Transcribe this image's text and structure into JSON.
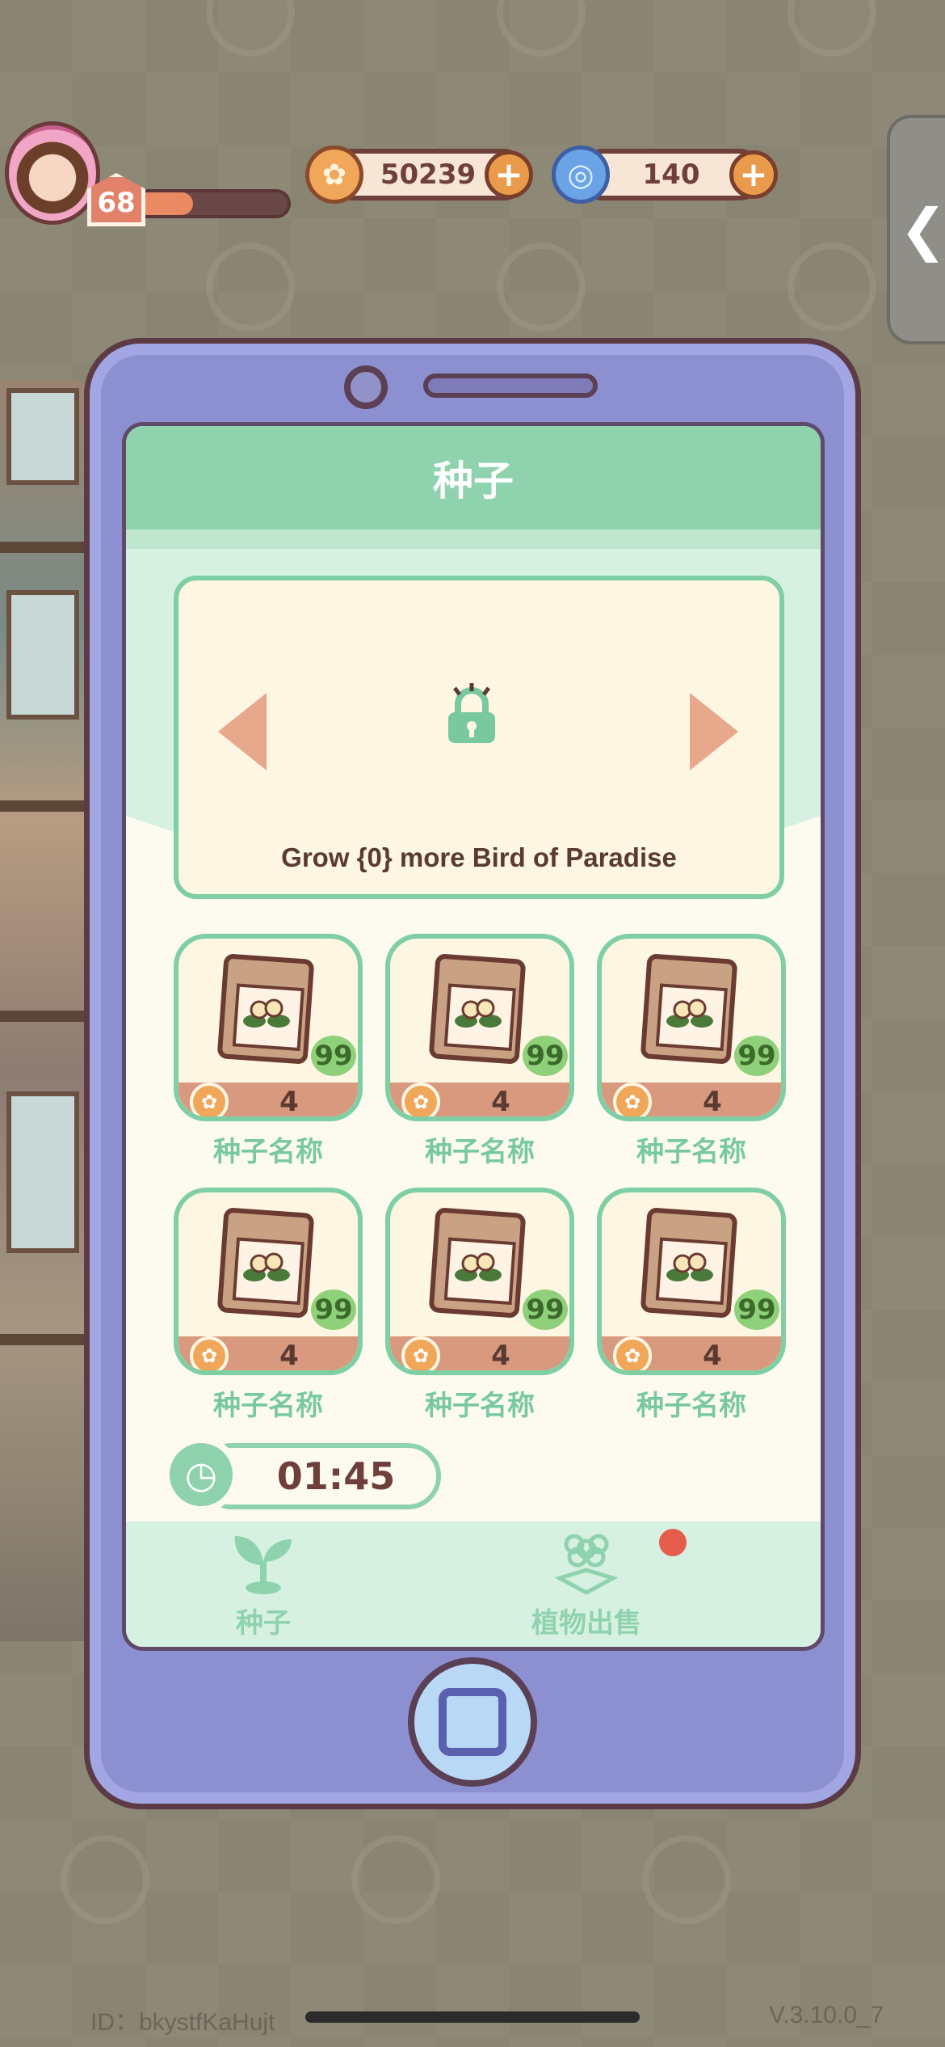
{
  "hud": {
    "level": "68",
    "coins": "50239",
    "gems": "140",
    "plus": "+",
    "side_arrow": "❮"
  },
  "panel": {
    "title": "种子",
    "unlock_text": "Grow {0} more Bird of Paradise"
  },
  "seeds": [
    {
      "name": "种子名称",
      "count": "99",
      "price": "4"
    },
    {
      "name": "种子名称",
      "count": "99",
      "price": "4"
    },
    {
      "name": "种子名称",
      "count": "99",
      "price": "4"
    },
    {
      "name": "种子名称",
      "count": "99",
      "price": "4"
    },
    {
      "name": "种子名称",
      "count": "99",
      "price": "4"
    },
    {
      "name": "种子名称",
      "count": "99",
      "price": "4"
    }
  ],
  "timer": {
    "value": "01:45"
  },
  "tabs": [
    {
      "label": "种子",
      "icon": "sprout-icon"
    },
    {
      "label": "植物出售",
      "icon": "flower-gift-icon"
    }
  ],
  "footer": {
    "id": "ID：bkystfKaHujt",
    "version": "V.3.10.0_7"
  },
  "colors": {
    "accent_green": "#8ed3ae",
    "phone_purple": "#8d90d0",
    "brown": "#6e3f3b"
  }
}
